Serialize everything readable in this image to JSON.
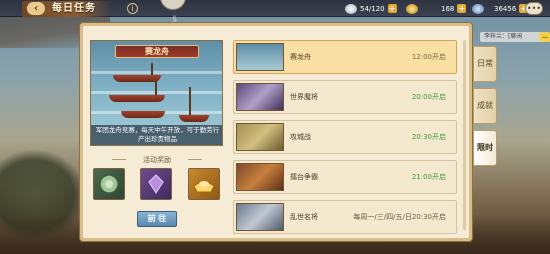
{
  "header": {
    "title": "每日任务",
    "back_icon": "back-arrow-icon",
    "help_icon": "info-icon",
    "top_mark": "╟"
  },
  "resources": {
    "stamina": {
      "value": "54/120",
      "icon": "silver-ingot-icon"
    },
    "gold": {
      "value": "168",
      "icon": "gold-ingot-icon"
    },
    "coins": {
      "value": "36456",
      "icon": "coin-icon"
    },
    "close_label": "•••"
  },
  "chat": {
    "text": "李梓兰：[聊闲",
    "bubble": "…"
  },
  "detail": {
    "banner": "赛龙舟",
    "caption": "军团龙舟竞赛，每天中午开放，可于勤劳行产出珍贵物品",
    "reward_title": "活动奖励",
    "rewards": [
      {
        "icon": "jade-token-icon"
      },
      {
        "icon": "purple-crystal-icon"
      },
      {
        "icon": "gold-ingot-icon"
      }
    ],
    "go_button": "前 往"
  },
  "events": [
    {
      "name": "赛龙舟",
      "time": "12:00开启",
      "active": true
    },
    {
      "name": "世界魔将",
      "time": "20:00开启",
      "active": false
    },
    {
      "name": "攻城战",
      "time": "20:30开启",
      "active": false
    },
    {
      "name": "擂台争霸",
      "time": "21:00开启",
      "active": false
    },
    {
      "name": "乱世名将",
      "time": "每周一/三/四/五/日20:30开启",
      "active": false
    }
  ],
  "side_tabs": [
    {
      "label": "日常",
      "active": false
    },
    {
      "label": "成就",
      "active": false
    },
    {
      "label": "限时",
      "active": true
    }
  ],
  "colors": {
    "time_green": "#3a9a35",
    "panel_bg": "#f6ecd6",
    "active_row": "#f9dfa3"
  }
}
